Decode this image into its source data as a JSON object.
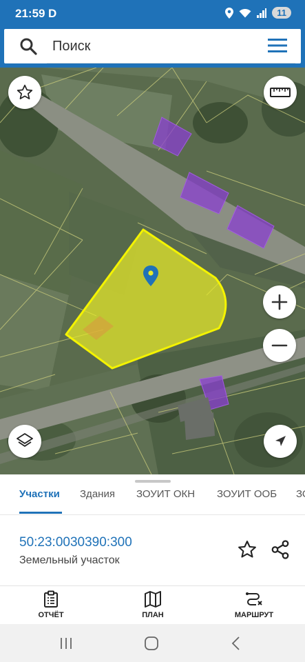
{
  "status": {
    "time": "21:59",
    "carrier_letter": "D",
    "battery": "11"
  },
  "search": {
    "placeholder": "Поиск"
  },
  "tabs": [
    {
      "label": "Участки",
      "active": true
    },
    {
      "label": "Здания",
      "active": false
    },
    {
      "label": "ЗОУИТ ОКН",
      "active": false
    },
    {
      "label": "ЗОУИТ ООБ",
      "active": false
    },
    {
      "label": "ЗО",
      "active": false
    }
  ],
  "parcel": {
    "cadastral_number": "50:23:0030390:300",
    "type": "Земельный участок"
  },
  "bottom_nav": [
    {
      "label": "ОТЧЁТ",
      "icon": "report-icon"
    },
    {
      "label": "ПЛАН",
      "icon": "map-icon"
    },
    {
      "label": "МАРШРУТ",
      "icon": "route-icon"
    }
  ],
  "colors": {
    "brand": "#1f72b8",
    "parcel_fill": "#e8ea2a",
    "parcel_stroke": "#f4f300",
    "building_fill": "#8a3fd0"
  }
}
